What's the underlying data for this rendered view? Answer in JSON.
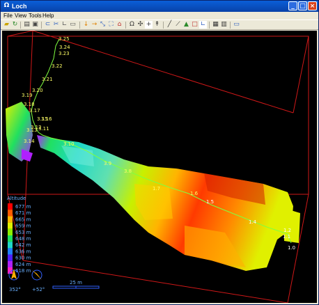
{
  "window": {
    "title": "Loch"
  },
  "menu": [
    "File",
    "View",
    "Tools",
    "Help"
  ],
  "toolbar_icons": [
    "open-folder-icon",
    "refresh-icon",
    "print-icon",
    "save-icon",
    "link-icon",
    "cut-icon",
    "measure-icon",
    "camera-icon",
    "arrow-down-icon",
    "arrow-right-icon",
    "shrink-icon",
    "fullscreen-icon",
    "home-icon",
    "omega-icon",
    "target-icon",
    "plus-icon",
    "north-icon",
    "pencil-icon",
    "ruler-icon",
    "terrain-icon",
    "box-icon",
    "axes-icon",
    "film-icon",
    "notes-icon",
    "screen-icon"
  ],
  "survey_labels": {
    "upper": [
      "3.25",
      "3.24",
      "3.23",
      "3.22",
      "3.21",
      "3.20",
      "3.19",
      "3.18",
      "3.17",
      "3.16",
      "3.15",
      "3.12",
      "3.11",
      "3.13",
      "3.14"
    ],
    "lower": [
      "3.10",
      "3.9",
      "3.8",
      "1.7",
      "1.6",
      "1.5",
      "1.4",
      "1.2",
      "1.1",
      "1.0"
    ]
  },
  "legend": {
    "title": "Altitude",
    "entries": [
      "677 m",
      "671 m",
      "665 m",
      "659 m",
      "653 m",
      "648 m",
      "642 m",
      "636 m",
      "630 m",
      "624 m",
      "618 m"
    ],
    "colors": [
      "#ff0000",
      "#ff5a00",
      "#ffb400",
      "#e0f000",
      "#8cf000",
      "#20e060",
      "#20d8c8",
      "#2080ff",
      "#5020ff",
      "#b020ff",
      "#ff20c0"
    ]
  },
  "compass": {
    "heading": "352°",
    "tilt": "+52°"
  },
  "scalebar": {
    "label": "25 m"
  }
}
